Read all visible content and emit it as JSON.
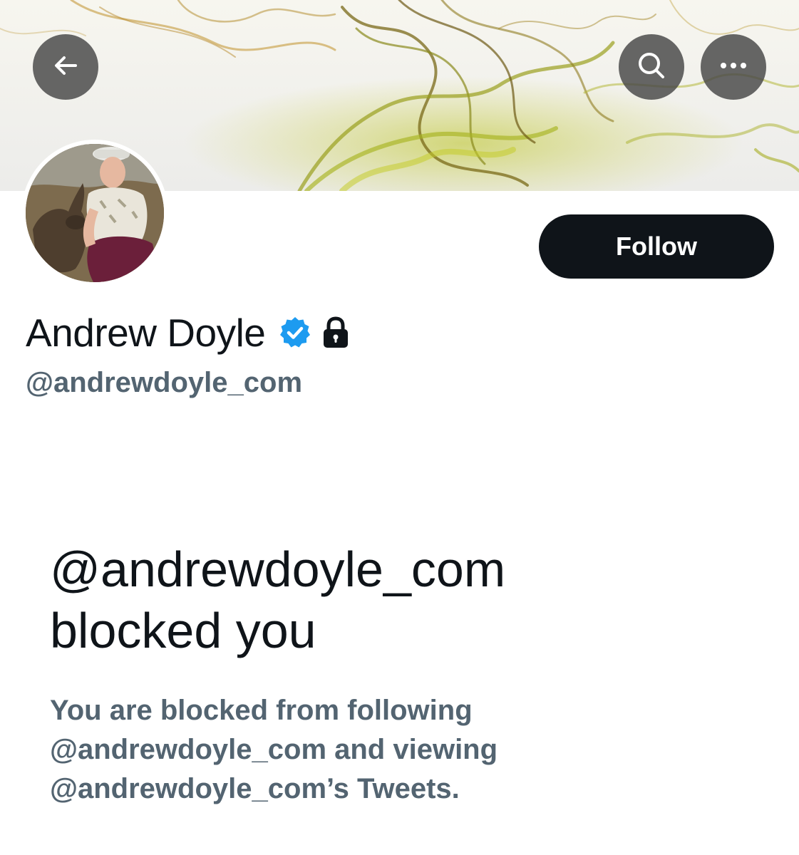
{
  "header": {
    "back_icon": "arrow-left-icon",
    "search_icon": "search-icon",
    "more_icon": "more-horizontal-icon"
  },
  "profile": {
    "display_name": "Andrew Doyle",
    "handle": "@andrewdoyle_com",
    "verified_icon": "verified-badge-icon",
    "verified_color": "#1d9bf0",
    "protected_icon": "lock-icon",
    "follow_label": "Follow"
  },
  "blocked": {
    "title_line1": "@andrewdoyle_com",
    "title_line2": "blocked you",
    "desc_line1": "You are blocked from following",
    "desc_line2": "@andrewdoyle_com and viewing",
    "desc_line3": "@andrewdoyle_com’s Tweets."
  },
  "colors": {
    "primary_text": "#0f1419",
    "secondary_text": "#536471",
    "follow_bg": "#0f1419",
    "follow_text": "#ffffff"
  }
}
